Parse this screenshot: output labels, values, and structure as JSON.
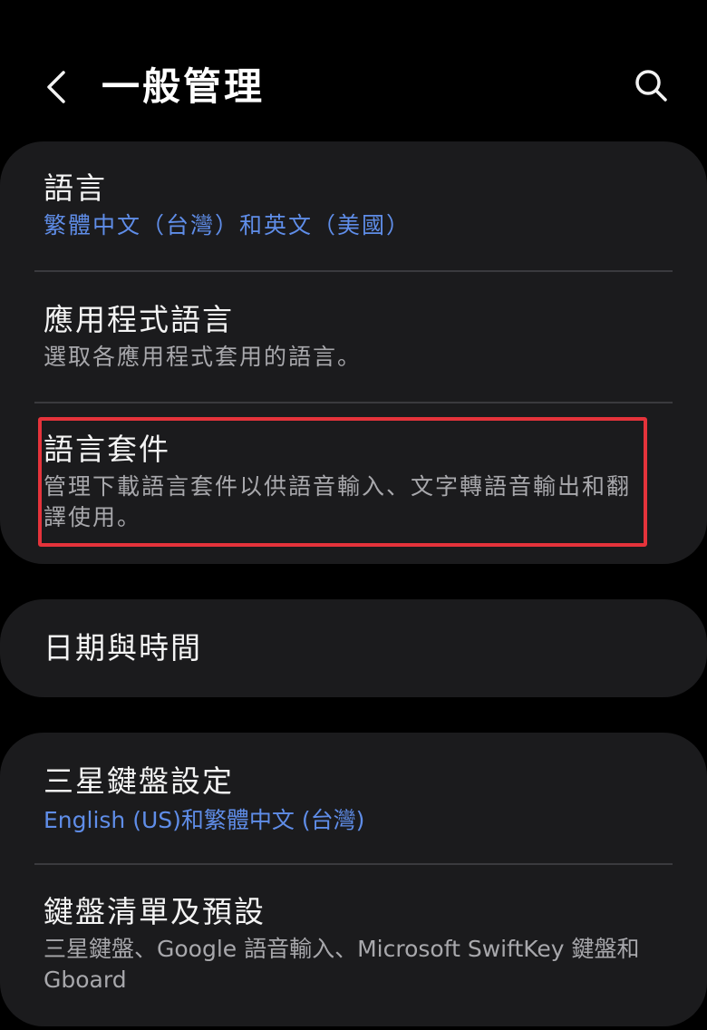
{
  "header": {
    "title": "一般管理"
  },
  "sections": {
    "language": {
      "title": "語言",
      "subtitle": "繁體中文（台灣）和英文（美國）"
    },
    "app_language": {
      "title": "應用程式語言",
      "subtitle": "選取各應用程式套用的語言。"
    },
    "language_packs": {
      "title": "語言套件",
      "subtitle": "管理下載語言套件以供語音輸入、文字轉語音輸出和翻譯使用。"
    },
    "date_time": {
      "title": "日期與時間"
    },
    "samsung_keyboard": {
      "title": "三星鍵盤設定",
      "subtitle": "English (US)和繁體中文 (台灣)"
    },
    "keyboard_list": {
      "title": "鍵盤清單及預設",
      "subtitle": "三星鍵盤、Google 語音輸入、Microsoft SwiftKey 鍵盤和 Gboard"
    }
  },
  "colors": {
    "background": "#000000",
    "card": "#1b1b1d",
    "accent": "#5f8de8",
    "highlight": "#e5333b"
  },
  "icons": {
    "back": "chevron-left-icon",
    "search": "search-icon"
  }
}
